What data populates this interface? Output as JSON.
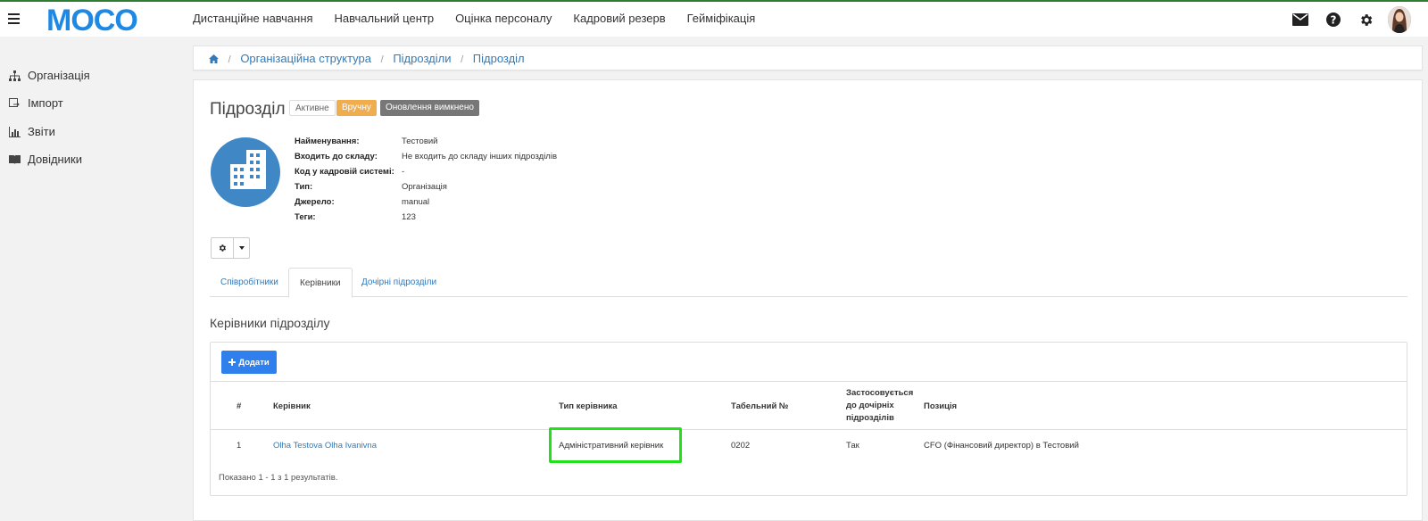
{
  "brand": {
    "logo_text": "MOCO",
    "accent": "#1e88e5",
    "topbar_border": "#2e7d32"
  },
  "topnav": [
    "Дистанційне навчання",
    "Навчальний центр",
    "Оцінка персоналу",
    "Кадровий резерв",
    "Гейміфікація"
  ],
  "top_icons": [
    "mail-icon",
    "help-icon",
    "gear-icon",
    "user-avatar"
  ],
  "sidebar": {
    "items": [
      {
        "label": "Організація",
        "icon": "org-tree-icon"
      },
      {
        "label": "Імпорт",
        "icon": "import-icon"
      },
      {
        "label": "Звіти",
        "icon": "chart-icon"
      },
      {
        "label": "Довідники",
        "icon": "book-icon"
      }
    ]
  },
  "breadcrumb": {
    "home_icon": "home-icon",
    "items": [
      "Організаційна структура",
      "Підрозділи",
      "Підрозділ"
    ]
  },
  "unit": {
    "title": "Підрозділ",
    "badges": {
      "active": "Активне",
      "manual": "Вручну",
      "updates": "Оновлення вимкнено"
    },
    "fields": [
      {
        "label": "Найменування:",
        "value": "Тестовий"
      },
      {
        "label": "Входить до складу:",
        "value": "Не входить до складу інших підрозділів"
      },
      {
        "label": "Код у кадровій системі:",
        "value": "-"
      },
      {
        "label": "Тип:",
        "value": "Організація"
      },
      {
        "label": "Джерело:",
        "value": "manual"
      },
      {
        "label": "Теги:",
        "value": "123"
      }
    ]
  },
  "tabs": [
    "Співробітники",
    "Керівники",
    "Дочірні підрозділи"
  ],
  "active_tab": "Керівники",
  "section_title": "Керівники підрозділу",
  "add_button": "Додати",
  "table": {
    "headers": [
      "#",
      "Керівник",
      "Тип керівника",
      "Табельний №",
      "Застосовується до дочірніх підрозділів",
      "Позиція"
    ],
    "header_lines_apply": [
      "Застосовується",
      "до дочірніх",
      "підрозділів"
    ],
    "rows": [
      {
        "num": "1",
        "manager": "Olha Testova Olha Ivanivna",
        "type": "Адміністративний керівник",
        "tab_no": "0202",
        "applies": "Так",
        "position": "CFO (Фінансовий директор) в Тестовий"
      }
    ],
    "summary": "Показано 1 - 1 з 1 результатів."
  }
}
